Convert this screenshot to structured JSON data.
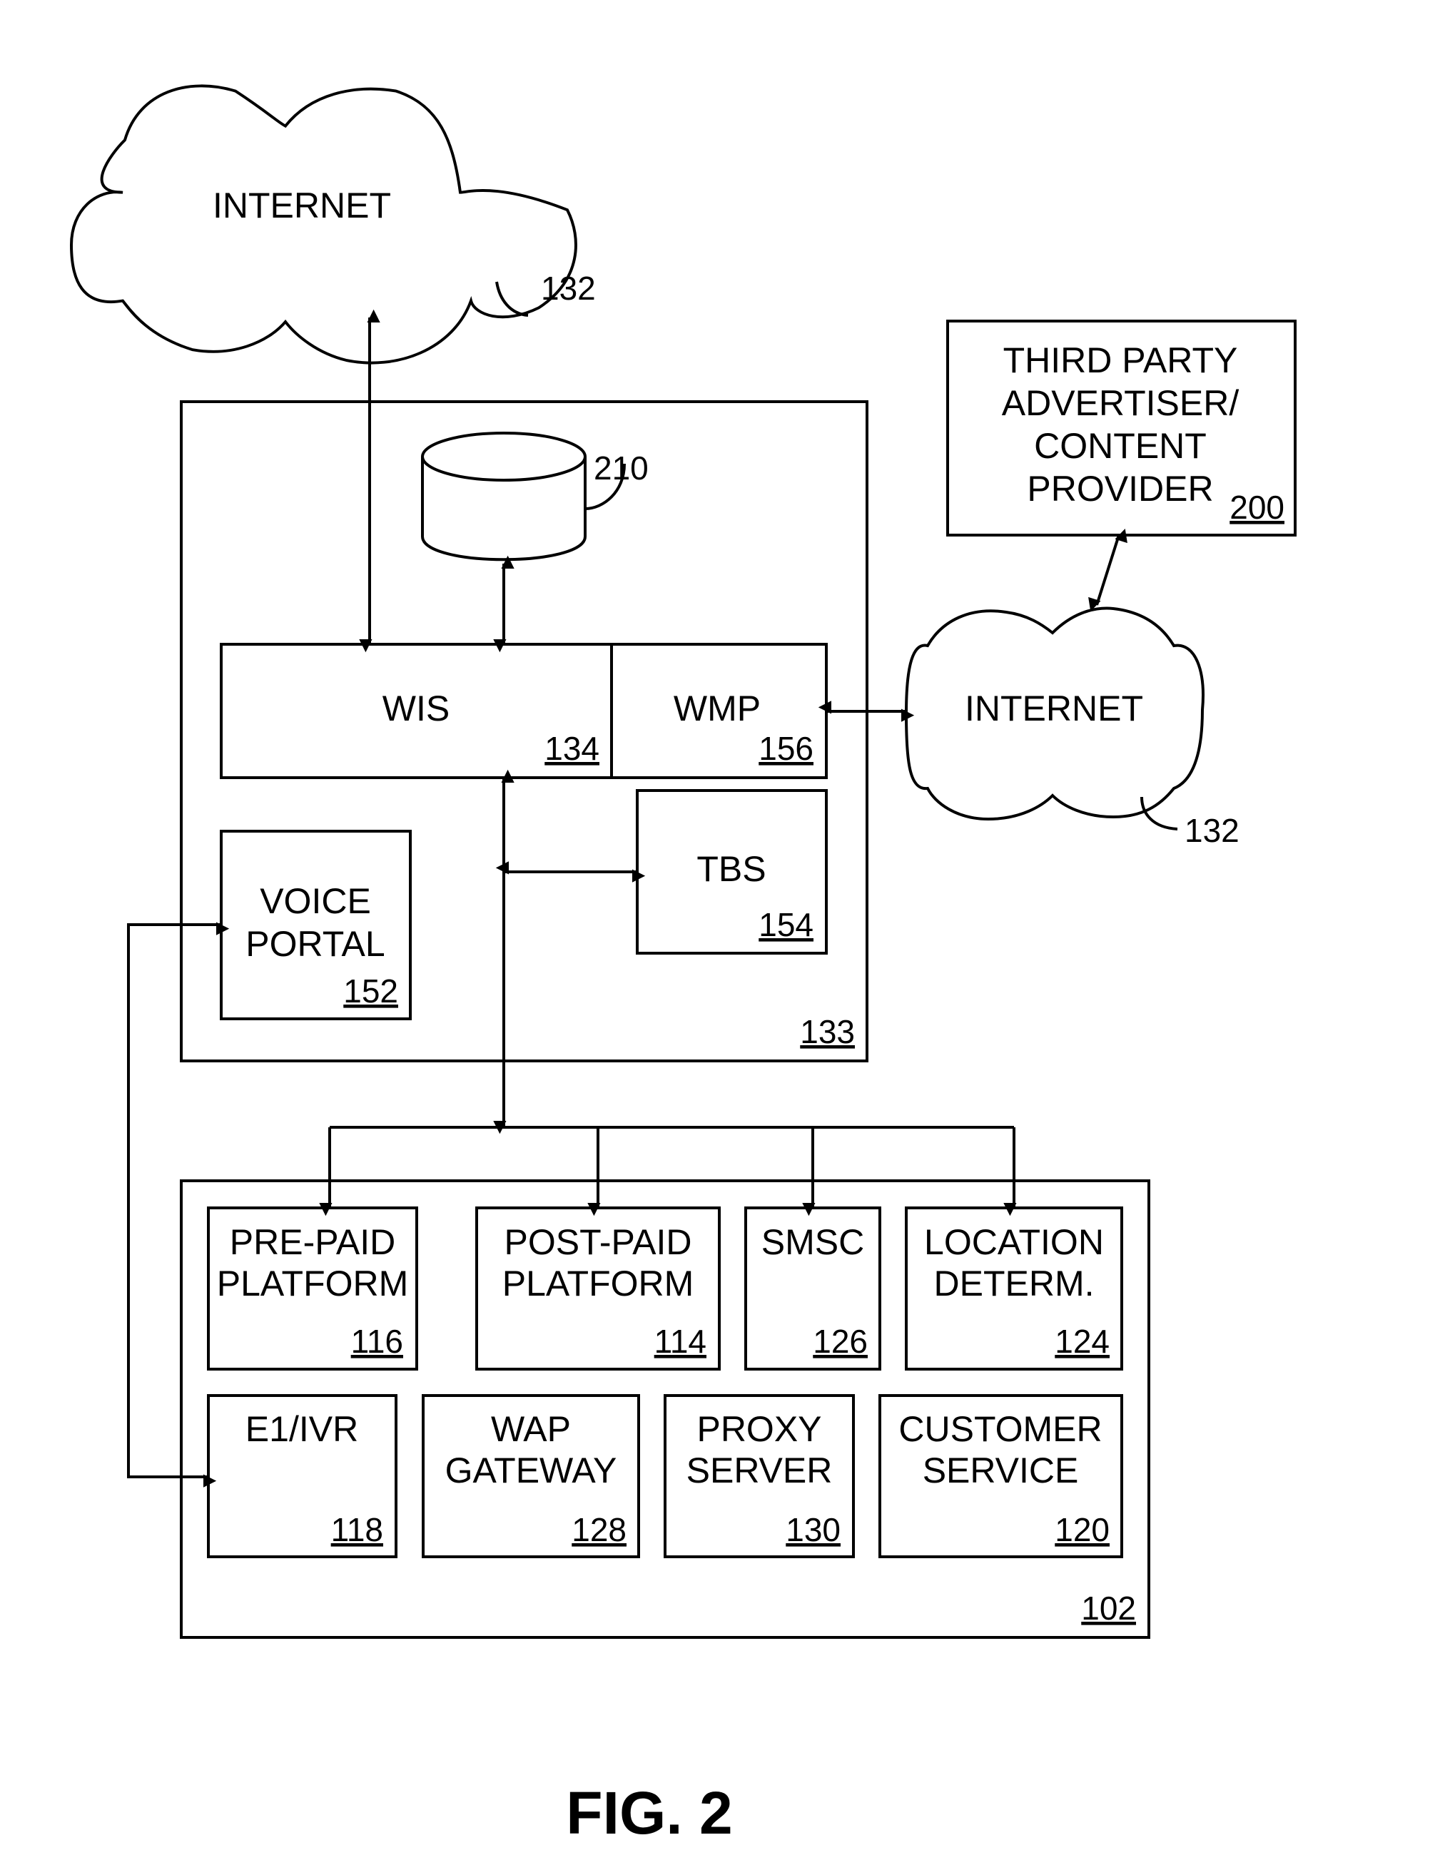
{
  "figure_label": "FIG. 2",
  "internet_top": {
    "label": "INTERNET",
    "ref": "132"
  },
  "internet_right": {
    "label": "INTERNET",
    "ref": "132"
  },
  "third_party": {
    "lines": [
      "THIRD PARTY",
      "ADVERTISER/",
      "CONTENT",
      "PROVIDER"
    ],
    "ref": "200"
  },
  "system_133": {
    "ref": "133"
  },
  "database": {
    "ref": "210"
  },
  "wis": {
    "label": "WIS",
    "ref": "134"
  },
  "wmp": {
    "label": "WMP",
    "ref": "156"
  },
  "tbs": {
    "label": "TBS",
    "ref": "154"
  },
  "voice_portal": {
    "lines": [
      "VOICE",
      "PORTAL"
    ],
    "ref": "152"
  },
  "network_102": {
    "ref": "102"
  },
  "components": [
    {
      "lines": [
        "PRE-PAID",
        "PLATFORM"
      ],
      "ref": "116"
    },
    {
      "lines": [
        "POST-PAID",
        "PLATFORM"
      ],
      "ref": "114"
    },
    {
      "lines": [
        "SMSC"
      ],
      "ref": "126"
    },
    {
      "lines": [
        "LOCATION",
        "DETERM."
      ],
      "ref": "124"
    },
    {
      "lines": [
        "E1/IVR"
      ],
      "ref": "118"
    },
    {
      "lines": [
        "WAP",
        "GATEWAY"
      ],
      "ref": "128"
    },
    {
      "lines": [
        "PROXY",
        "SERVER"
      ],
      "ref": "130"
    },
    {
      "lines": [
        "CUSTOMER",
        "SERVICE"
      ],
      "ref": "120"
    }
  ]
}
